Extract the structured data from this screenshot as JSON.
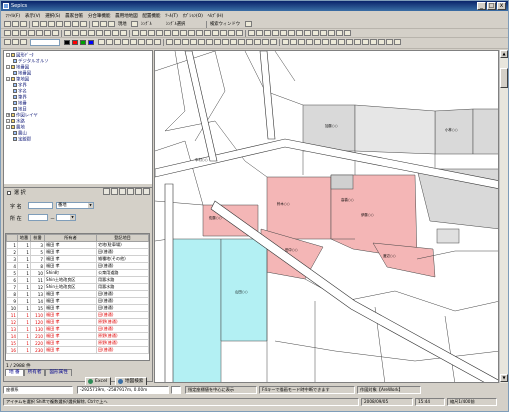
{
  "window": {
    "title": "Sepics",
    "min": "_",
    "max": "□",
    "close": "x"
  },
  "menu": [
    "ﾌｧｲﾙ(F)",
    "表示(V)",
    "選択(S)",
    "農家台帳",
    "分合筆機能",
    "農用地地図",
    "配置機能",
    "ﾂｰﾙ(T)",
    "ｵﾌﾟｼｮﾝ(O)",
    "ﾍﾙﾌﾟ(H)"
  ],
  "toolbar": {
    "zoom_combo": "",
    "labels": [
      "現地",
      "ｼﾝｸﾞﾙ",
      "ｼﾝｸﾞﾙ選択",
      "検索ウィンドウ"
    ]
  },
  "tree": [
    {
      "level": 0,
      "exp": "-",
      "label": "図形ﾃﾞｰﾀ"
    },
    {
      "level": 1,
      "exp": "",
      "label": "デジタルオルソ"
    },
    {
      "level": 0,
      "exp": "-",
      "label": "地番図"
    },
    {
      "level": 1,
      "exp": "",
      "label": "地番図"
    },
    {
      "level": 0,
      "exp": "-",
      "label": "筆地図"
    },
    {
      "level": 1,
      "exp": "",
      "label": "字界"
    },
    {
      "level": 1,
      "exp": "",
      "label": "字名"
    },
    {
      "level": 1,
      "exp": "",
      "label": "筆界"
    },
    {
      "level": 1,
      "exp": "",
      "label": "地番"
    },
    {
      "level": 1,
      "exp": "",
      "label": "地目"
    },
    {
      "level": 0,
      "exp": "+",
      "label": "作図レイヤ"
    },
    {
      "level": 0,
      "exp": "-",
      "label": "水路"
    },
    {
      "level": 0,
      "exp": "-",
      "label": "農地"
    },
    {
      "level": 1,
      "exp": "",
      "label": "農山"
    },
    {
      "level": 1,
      "exp": "",
      "label": "宝飯郡"
    }
  ],
  "search_panel": {
    "title": "選 択",
    "field1_label": "字 名",
    "field1_value": "",
    "field1_combo": "番地",
    "field2_label": "所 在",
    "field2_value": "",
    "field2_sep": "－"
  },
  "grid": {
    "headers": [
      "",
      "地番",
      "枝番",
      "所有者",
      "登記地目"
    ],
    "rows": [
      {
        "n": "1",
        "a": "1",
        "b": "3",
        "owner": "福田 孝",
        "use": "宅地(駐車場)",
        "red": false
      },
      {
        "n": "2",
        "a": "1",
        "b": "5",
        "owner": "福田 孝",
        "use": "田(普通)",
        "red": false
      },
      {
        "n": "3",
        "a": "1",
        "b": "7",
        "owner": "福田 孝",
        "use": "雑種地(その他)",
        "red": false
      },
      {
        "n": "4",
        "a": "1",
        "b": "8",
        "owner": "福田 孝",
        "use": "田(普通)",
        "red": false
      },
      {
        "n": "5",
        "a": "1",
        "b": "10",
        "owner": "Shin町",
        "use": "公衆用道路",
        "red": false
      },
      {
        "n": "6",
        "a": "1",
        "b": "11",
        "owner": "Shin土地改良区",
        "use": "用悪水路",
        "red": false
      },
      {
        "n": "7",
        "a": "1",
        "b": "12",
        "owner": "Shin土地改良区",
        "use": "用悪水路",
        "red": false
      },
      {
        "n": "8",
        "a": "1",
        "b": "13",
        "owner": "福田 孝",
        "use": "田(普通)",
        "red": false
      },
      {
        "n": "9",
        "a": "1",
        "b": "14",
        "owner": "福田 孝",
        "use": "田(普通)",
        "red": false
      },
      {
        "n": "10",
        "a": "1",
        "b": "15",
        "owner": "福田 孝",
        "use": "田(普通)",
        "red": false
      },
      {
        "n": "11",
        "a": "1",
        "b": "110",
        "owner": "福田 孝",
        "use": "田(普通)",
        "red": true
      },
      {
        "n": "12",
        "a": "1",
        "b": "120",
        "owner": "福田 孝",
        "use": "原野(普通)",
        "red": true
      },
      {
        "n": "13",
        "a": "1",
        "b": "130",
        "owner": "福田 孝",
        "use": "田(普通)",
        "red": true
      },
      {
        "n": "14",
        "a": "1",
        "b": "210",
        "owner": "福田 孝",
        "use": "原野(普通)",
        "red": true
      },
      {
        "n": "15",
        "a": "1",
        "b": "220",
        "owner": "福田 孝",
        "use": "原野(普通)",
        "red": true
      },
      {
        "n": "16",
        "a": "1",
        "b": "230",
        "owner": "福田 孝",
        "use": "田(普通)",
        "red": true
      }
    ]
  },
  "record_count": "1 / 2988 件",
  "tabs": [
    "地 番",
    "所有者",
    "図形属性"
  ],
  "buttons": {
    "excel": "Excel",
    "map_search": "地図検索"
  },
  "status": {
    "left_combo": "座標系",
    "coords": "-2925719m, -2587917m, 0.00m",
    "check_label": "指定座標値を中心に表示",
    "hint": "F4キーで描画モード時中断できます",
    "mode": "作図対象【AreWork】",
    "bottom_left": "アイテムを選択 Shiftで複数選択/選択解除, Ctrlで上へ",
    "date": "2008/09/05",
    "time": "15:44",
    "scale": "縮尺1/400前"
  },
  "colors": {
    "pink": "#f4b6b6",
    "cyan": "#b3f0f3",
    "gray": "#d9d9d9",
    "road": "#ffffff",
    "title": "#0a246a"
  },
  "map_labels": [
    "佐藤○○",
    "山田○○",
    "鈴木○○",
    "田中○○",
    "高橋○○",
    "伊藤○○",
    "渡辺○○",
    "中村○○",
    "小林○○",
    "加藤○○"
  ]
}
